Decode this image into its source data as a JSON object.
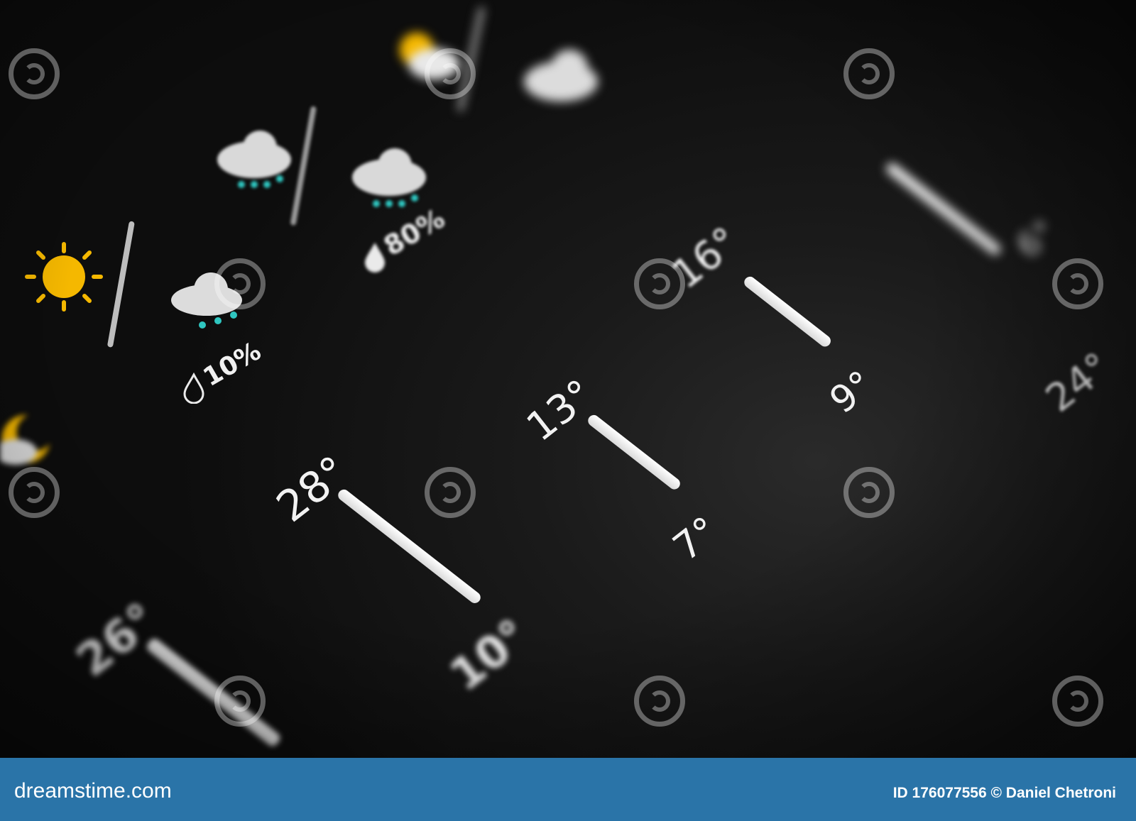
{
  "forecast": {
    "temps": {
      "t28": "28°",
      "t10": "10°",
      "t13": "13°",
      "t7": "7°",
      "t16": "16°",
      "t9": "9°",
      "t26": "26°",
      "t24": "24°",
      "t6": "6°"
    },
    "precip": {
      "p10": "10%",
      "p80": "80%"
    }
  },
  "icons": [
    "sun-icon",
    "cloud-rain-icon",
    "partly-sunny-icon",
    "cloud-icon",
    "moon-cloud-icon",
    "raindrop-icon"
  ],
  "colors": {
    "background": "#141414",
    "text": "#f2f2f2",
    "sun": "#f5b800",
    "rain": "#2fc6c0",
    "footer": "#2a74a8"
  },
  "footer": {
    "brand": "dreamstime.com",
    "credit": "ID 176077556 © Daniel Chetroni"
  }
}
